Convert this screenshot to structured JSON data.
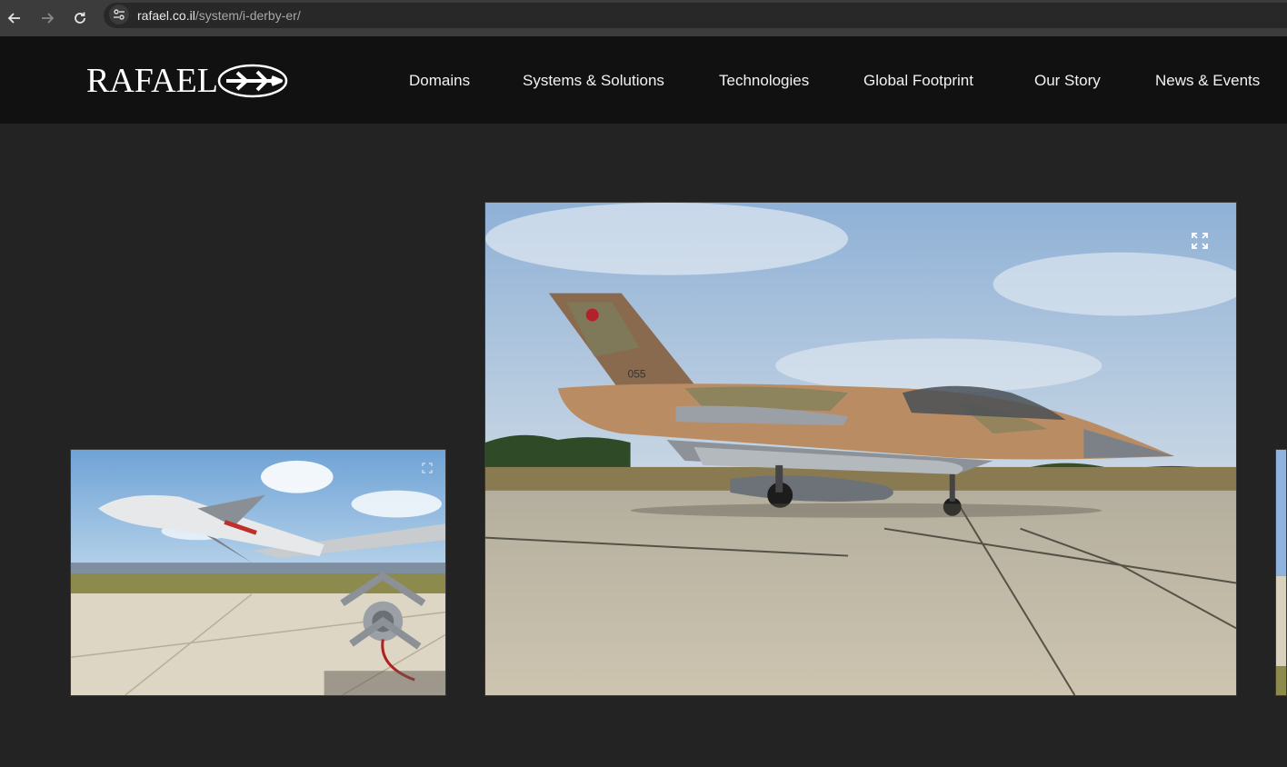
{
  "browser": {
    "url_domain": "rafael.co.il",
    "url_path": "/system/i-derby-er/",
    "icons": [
      "back-arrow-icon",
      "forward-arrow-icon",
      "reload-icon",
      "site-info-icon"
    ]
  },
  "header": {
    "logo_text": "RAFAEL",
    "nav": [
      {
        "label": "Domains"
      },
      {
        "label": "Systems & Solutions"
      },
      {
        "label": "Technologies"
      },
      {
        "label": "Global Footprint"
      },
      {
        "label": "Our Story"
      },
      {
        "label": "News & Events"
      }
    ]
  },
  "gallery": {
    "slides": [
      {
        "name": "missile-closeup-photo",
        "icon": "expand-icon"
      },
      {
        "name": "f16-jet-photo",
        "icon": "expand-icon"
      },
      {
        "name": "next-slide-photo"
      }
    ]
  },
  "colors": {
    "header_bg": "#111111",
    "page_bg": "#232323",
    "browser_bg": "#3c3c3c"
  }
}
